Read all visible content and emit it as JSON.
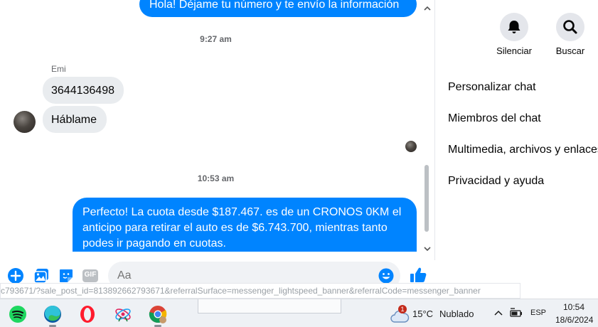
{
  "chat": {
    "messages": [
      {
        "text": "Hola! Déjame tu número y te envío la información",
        "direction": "out"
      },
      {
        "timestamp": "9:27 am"
      },
      {
        "sender": "Emi"
      },
      {
        "text": "3644136498",
        "direction": "in"
      },
      {
        "text": "Háblame",
        "direction": "in"
      },
      {
        "timestamp": "10:53 am"
      },
      {
        "text": "Perfecto! La cuota desde $187.467. es de un CRONOS 0KM el anticipo para retirar el auto es de $6.743.700, mientras tanto podes ir pagando en cuotas.",
        "direction": "out"
      }
    ],
    "msg1_text": "Hola! Déjame tu número y te envío la información",
    "ts1": "9:27 am",
    "sender_name": "Emi",
    "msg2_text": "3644136498",
    "msg3_text": "Háblame",
    "ts2": "10:53 am",
    "msg4_line1": "Perfecto! La cuota desde $187.467. es de un CRONOS 0KM el",
    "msg4_line2": "anticipo para retirar el auto es de $6.743.700, mientras tanto",
    "msg4_line3": "podes ir pagando en cuotas."
  },
  "composer": {
    "placeholder": "Aa",
    "icons": [
      "plus-circle-icon",
      "image-icon",
      "sticker-icon",
      "gif-icon",
      "emoji-icon",
      "like-icon"
    ],
    "gif_label": "GIF"
  },
  "panel": {
    "mute_label": "Silenciar",
    "search_label": "Buscar",
    "menu": [
      "Personalizar chat",
      "Miembros del chat",
      "Multimedia, archivos y enlaces",
      "Privacidad y ayuda"
    ]
  },
  "url_tooltip": "c793671/?sale_post_id=813892662793671&referralSurface=messenger_lightspeed_banner&referralCode=messenger_banner",
  "taskbar": {
    "apps": [
      "spotify-icon",
      "edge-icon",
      "opera-icon",
      "app-icon",
      "chrome-icon"
    ],
    "weather_temp": "15°C",
    "weather_desc": "Nublado",
    "weather_badge": "1",
    "language": "ESP",
    "time": "10:54",
    "date": "18/6/2024"
  },
  "colors": {
    "accent": "#0084ff",
    "incoming_bubble": "#e9ecef",
    "taskbar": "#eef1f5"
  }
}
